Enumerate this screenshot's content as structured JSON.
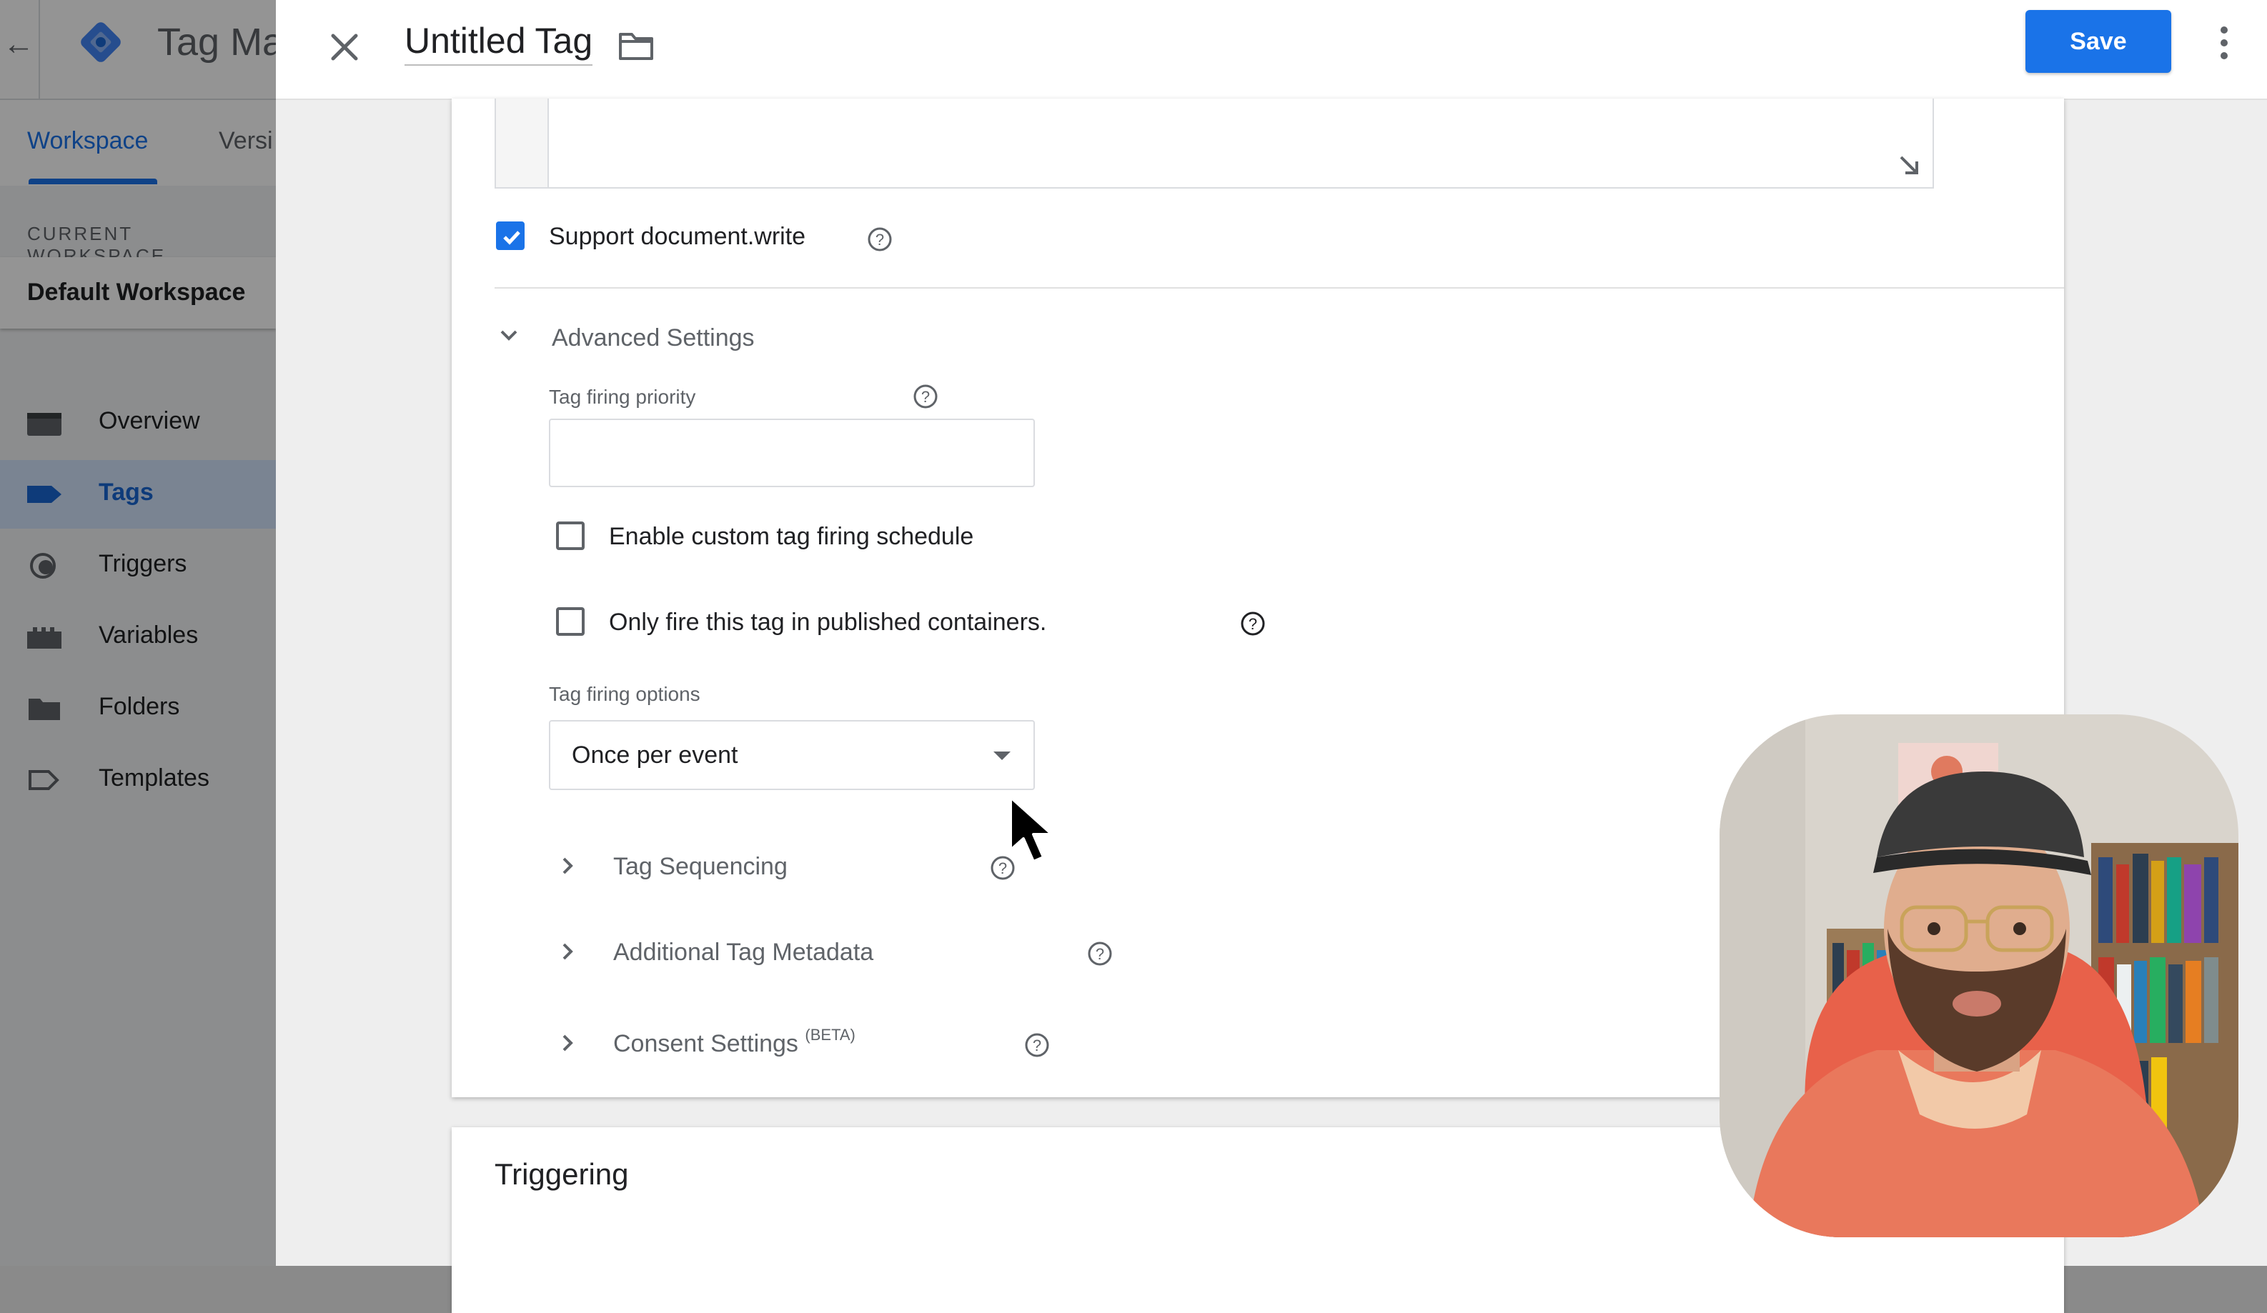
{
  "app": {
    "title": "Tag Ma",
    "tabs": [
      {
        "label": "Workspace",
        "active": true
      },
      {
        "label": "Versi",
        "active": false
      }
    ],
    "workspace_section_label": "CURRENT WORKSPACE",
    "workspace_name": "Default Workspace",
    "nav": [
      {
        "label": "Overview",
        "icon": "overview-icon",
        "active": false
      },
      {
        "label": "Tags",
        "icon": "tag-icon",
        "active": true
      },
      {
        "label": "Triggers",
        "icon": "trigger-icon",
        "active": false
      },
      {
        "label": "Variables",
        "icon": "variables-icon",
        "active": false
      },
      {
        "label": "Folders",
        "icon": "folder-icon",
        "active": false
      },
      {
        "label": "Templates",
        "icon": "template-icon",
        "active": false
      }
    ]
  },
  "editor": {
    "tag_name": "Untitled Tag",
    "save_label": "Save",
    "support_document_write": {
      "label": "Support document.write",
      "checked": true
    },
    "advanced_settings": {
      "label": "Advanced Settings",
      "expanded": true,
      "firing_priority": {
        "label": "Tag firing priority",
        "value": ""
      },
      "custom_schedule": {
        "label": "Enable custom tag firing schedule",
        "checked": false
      },
      "published_only": {
        "label": "Only fire this tag in published containers.",
        "checked": false
      },
      "firing_options": {
        "label": "Tag firing options",
        "selected": "Once per event"
      },
      "sections": [
        {
          "label": "Tag Sequencing",
          "expanded": false
        },
        {
          "label": "Additional Tag Metadata",
          "expanded": false
        },
        {
          "label": "Consent Settings",
          "superscript": "(BETA)",
          "expanded": false
        }
      ]
    },
    "triggering_title": "Triggering"
  },
  "colors": {
    "accent": "#1a73e8",
    "nav_active_bg": "#d2e3fc",
    "save_button": "#1a73e8"
  }
}
